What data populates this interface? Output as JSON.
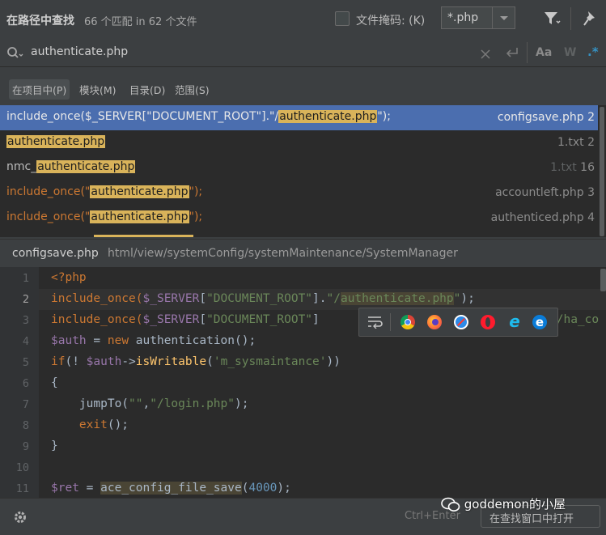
{
  "header": {
    "title": "在路径中查找",
    "match_count": "66 个匹配 in 62 个文件",
    "file_mask_label": "文件掩码: (K)",
    "file_mask_value": "*.php",
    "file_mask_checked": false
  },
  "search": {
    "query": "authenticate.php",
    "option_case": "Aa",
    "option_words": "W",
    "option_regex": ".*"
  },
  "scopes": [
    {
      "label": "在项目中(P)",
      "active": true
    },
    {
      "label": "模块(M)",
      "active": false
    },
    {
      "label": "目录(D)",
      "active": false
    },
    {
      "label": "范围(S)",
      "active": false
    }
  ],
  "results": [
    {
      "pre": "include_once($_SERVER[\"DOCUMENT_ROOT\"].\"/",
      "match": "authenticate.php",
      "post": "\");",
      "file": "configsave.php",
      "line": "2",
      "selected": true,
      "kw": false
    },
    {
      "pre": "",
      "match": "authenticate.php",
      "post": "",
      "file": "1.txt",
      "line": "2",
      "selected": false,
      "kw": false
    },
    {
      "pre": "nmc_",
      "match": "authenticate.php",
      "post": "",
      "file": "1.txt",
      "line": "16",
      "selected": false,
      "kw": false
    },
    {
      "pre": "include_once(\"",
      "match": "authenticate.php",
      "post": "\");",
      "file": "accountleft.php",
      "line": "3",
      "selected": false,
      "kw": true
    },
    {
      "pre": "include_once(\"",
      "match": "authenticate.php",
      "post": "\");",
      "file": "authenticed.php",
      "line": "4",
      "selected": false,
      "kw": true
    }
  ],
  "preview": {
    "file_name": "configsave.php",
    "file_path": "html/view/systemConfig/systemMaintenance/SystemManager"
  },
  "editor": {
    "line_numbers": [
      "1",
      "2",
      "3",
      "4",
      "5",
      "6",
      "7",
      "8",
      "9",
      "10",
      "11"
    ],
    "lines": {
      "l1": "<?php",
      "l2a": "include_once(",
      "l2b": "$_SERVER",
      "l2c": "[",
      "l2d": "\"DOCUMENT_ROOT\"",
      "l2e": "].",
      "l2f": "\"/",
      "l2g": "authenticate.php",
      "l2h": "\"",
      "l2i": ");",
      "l3a": "include_once(",
      "l3b": "$_SERVER",
      "l3c": "[",
      "l3d": "\"DOCUMENT_ROOT\"",
      "l3e": "]",
      "l3f": "g/ha_co",
      "l4a": "$auth",
      "l4b": " = ",
      "l4c": "new",
      "l4d": " authentication();",
      "l5a": "if",
      "l5b": "(! ",
      "l5c": "$auth",
      "l5d": "->",
      "l5e": "isWritable",
      "l5f": "(",
      "l5g": "'m_sysmaintance'",
      "l5h": "))",
      "l6": "{",
      "l7a": "    jumpTo(",
      "l7b": "\"\"",
      "l7c": ",",
      "l7d": "\"/login.php\"",
      "l7e": ");",
      "l8a": "    ",
      "l8b": "exit",
      "l8c": "();",
      "l9": "}",
      "l11a": "$ret",
      "l11b": " = ",
      "l11c": "ace_config_file_save",
      "l11d": "(",
      "l11e": "4000",
      "l11f": ");"
    }
  },
  "popup": {
    "icons": [
      "wrap-icon",
      "chrome-icon",
      "firefox-icon",
      "safari-icon",
      "opera-icon",
      "ie-icon",
      "edge-icon"
    ]
  },
  "bottom": {
    "shortcut_hint": "Ctrl+Enter",
    "open_button": "在查找窗口中打开",
    "watermark": "goddemon的小屋"
  },
  "colors": {
    "selection": "#4b6eaf",
    "match_highlight": "#d9b35a",
    "keyword": "#cc7832",
    "string": "#6a8759"
  }
}
